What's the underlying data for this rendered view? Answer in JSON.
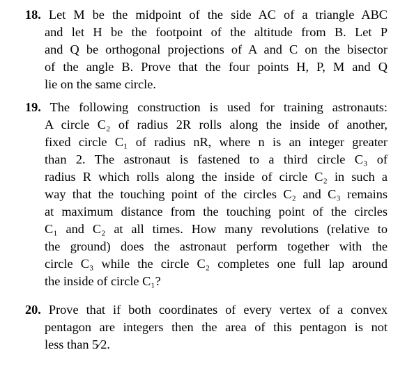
{
  "problems": [
    {
      "number": "18.",
      "lines": [
        "Let M be the midpoint of the side AC of a triangle ABC",
        "and let H be the footpoint of the altitude from B. Let P",
        "and Q be orthogonal projections of A and C on the bisector",
        "of the angle B. Prove that the four points H, P, M and Q",
        "lie on the same circle."
      ]
    },
    {
      "number": "19.",
      "lines": [
        "The following construction is used for training astronauts:",
        "A circle C₂ of radius 2R rolls along the inside of another,",
        "fixed circle C₁ of radius nR, where n is an integer greater",
        "than 2. The astronaut is fastened to a third circle C₃ of",
        "radius R which rolls along the inside of circle C₂ in such a",
        "way that the touching point of the circles C₂ and C₃ remains",
        "at maximum distance from the touching point of the circles",
        "C₁ and C₂ at all times. How many revolutions (relative to",
        "the ground) does the astronaut perform together with the",
        "circle C₃ while the circle C₂ completes one full lap around",
        "the inside of circle C₁?"
      ]
    },
    {
      "number": "20.",
      "lines": [
        "Prove that if both coordinates of every vertex of a convex",
        "pentagon are integers then the area of this pentagon is not",
        "less than 5⁄2."
      ]
    }
  ]
}
